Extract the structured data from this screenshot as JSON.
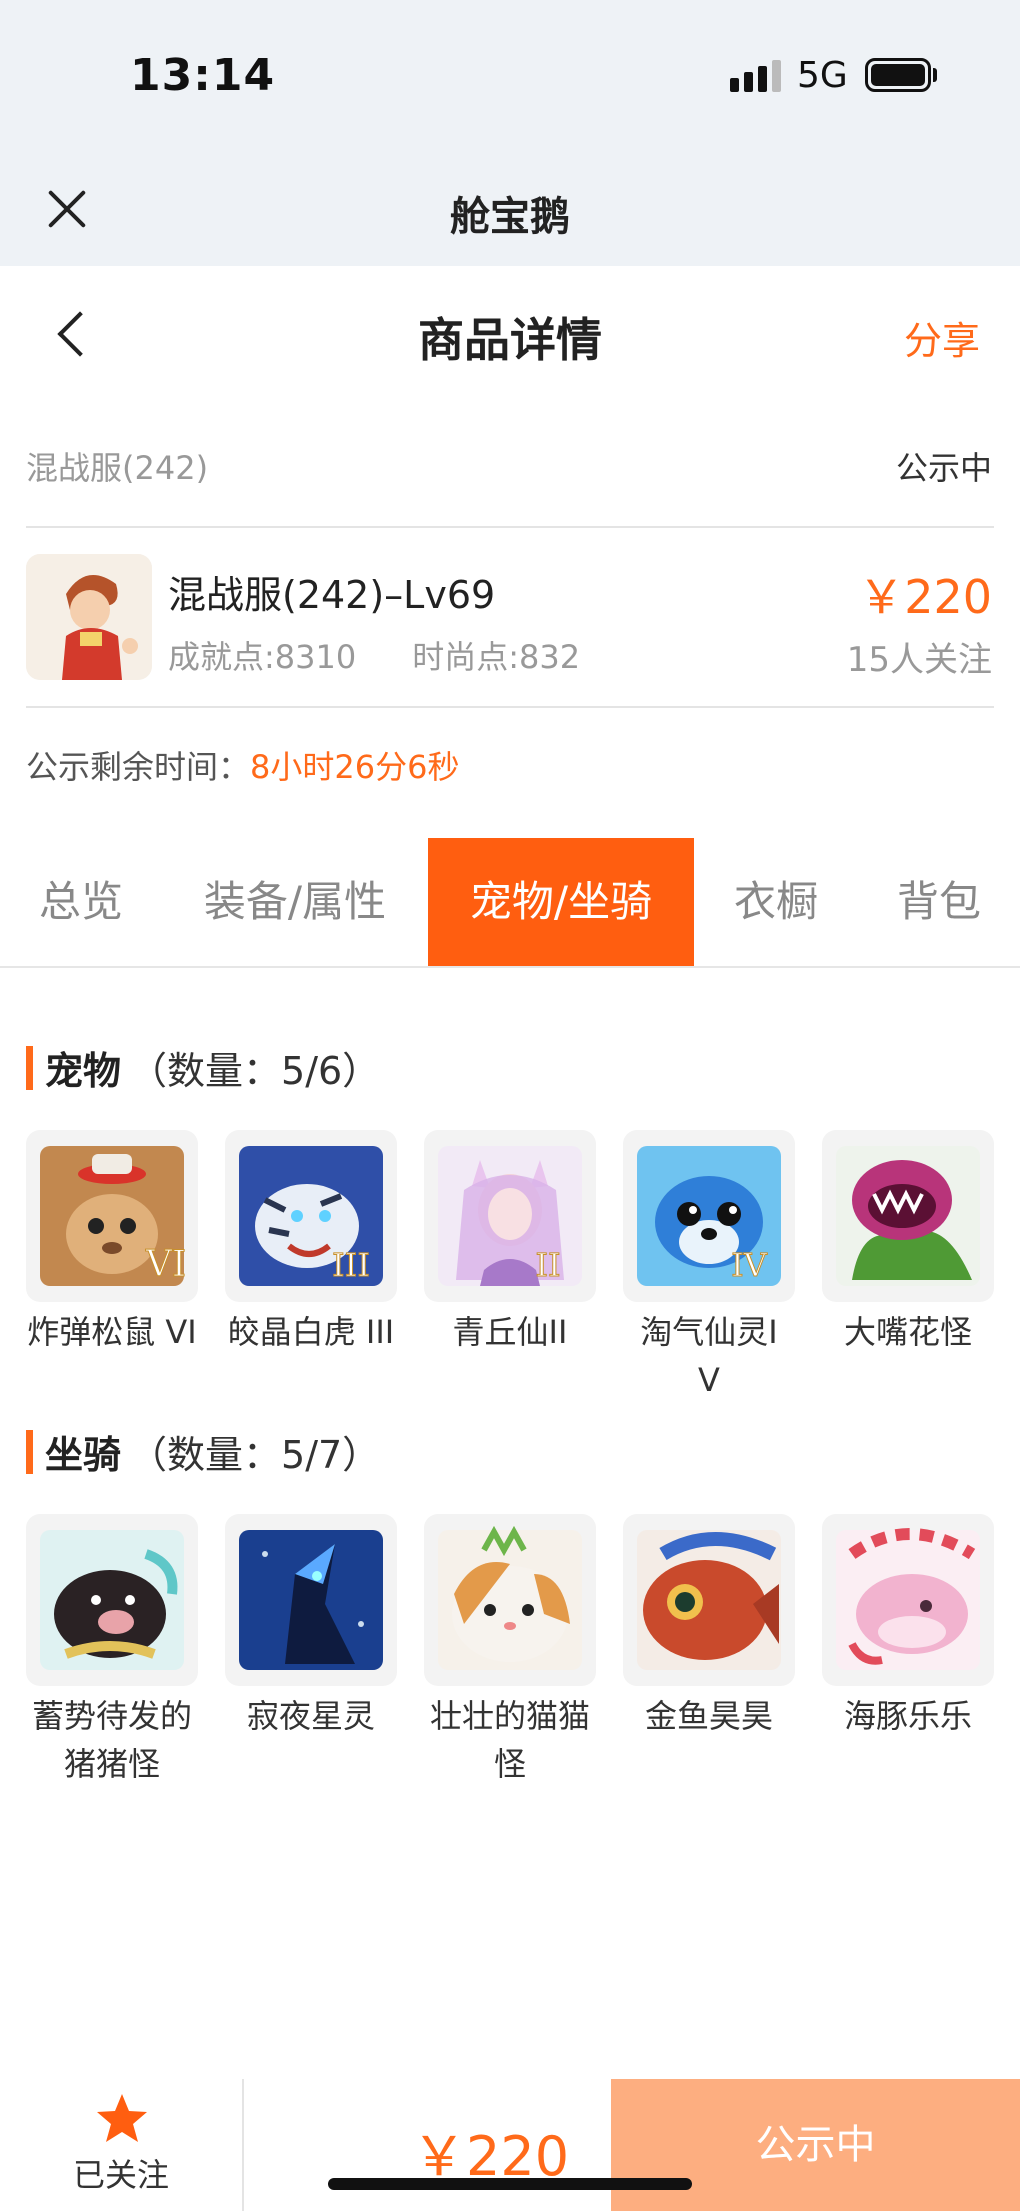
{
  "status_bar": {
    "time": "13:14",
    "network": "5G"
  },
  "app_header": {
    "title": "舱宝鹅"
  },
  "page_header": {
    "title": "商品详情",
    "share_label": "分享"
  },
  "server": {
    "name": "混战服(242)",
    "status": "公示中"
  },
  "product": {
    "name": "混战服(242)–Lv69",
    "achievement": "成就点:8310",
    "fashion": "时尚点:832",
    "price": "￥220",
    "followers": "15人关注"
  },
  "countdown": {
    "label": "公示剩余时间：",
    "value": "8小时26分6秒"
  },
  "tabs": [
    {
      "label": "总览"
    },
    {
      "label": "装备/属性"
    },
    {
      "label": "宠物/坐骑"
    },
    {
      "label": "衣橱"
    },
    {
      "label": "背包"
    }
  ],
  "active_tab": "宠物/坐骑",
  "pets": {
    "title": "宠物",
    "count": "（数量：5/6）",
    "items": [
      {
        "name": "炸弹松鼠 VI",
        "badge": "VI"
      },
      {
        "name": "皎晶白虎 III",
        "badge": "III"
      },
      {
        "name": "青丘仙II",
        "badge": "II"
      },
      {
        "name": "淘气仙灵IV",
        "badge": "IV"
      },
      {
        "name": "大嘴花怪",
        "badge": ""
      }
    ]
  },
  "mounts": {
    "title": "坐骑",
    "count": "（数量：5/7）",
    "items": [
      {
        "name": "蓄势待发的猪猪怪"
      },
      {
        "name": "寂夜星灵"
      },
      {
        "name": "壮壮的猫猫怪"
      },
      {
        "name": "金鱼昊昊"
      },
      {
        "name": "海豚乐乐"
      }
    ]
  },
  "bottom_bar": {
    "follow_label": "已关注",
    "price": "￥220",
    "cta_label": "公示中"
  },
  "colors": {
    "accent": "#ff5e10",
    "cta": "#fdae80",
    "text_muted": "#999999"
  }
}
